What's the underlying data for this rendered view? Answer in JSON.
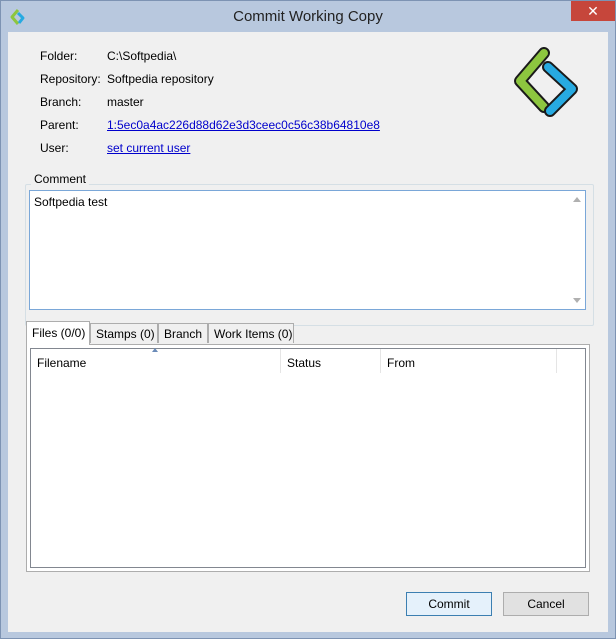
{
  "window": {
    "title": "Commit Working Copy",
    "close_glyph": "✕"
  },
  "info": {
    "folder_label": "Folder:",
    "folder_value": "C:\\Softpedia\\",
    "repository_label": "Repository:",
    "repository_value": "Softpedia repository",
    "branch_label": "Branch:",
    "branch_value": "master",
    "parent_label": "Parent:",
    "parent_value": "1:5ec0a4ac226d88d62e3d3ceec0c56c38b64810e8",
    "user_label": "User:",
    "user_value": "set current user"
  },
  "comment": {
    "label": "Comment",
    "text": "Softpedia test"
  },
  "tabs": [
    {
      "label": "Files (0/0)"
    },
    {
      "label": "Stamps (0)"
    },
    {
      "label": "Branch"
    },
    {
      "label": "Work Items (0)"
    }
  ],
  "columns": [
    {
      "label": "Filename"
    },
    {
      "label": "Status"
    },
    {
      "label": "From"
    }
  ],
  "buttons": {
    "commit": "Commit",
    "cancel": "Cancel"
  },
  "colors": {
    "logo_green": "#8dc63f",
    "logo_blue": "#27aae1",
    "link": "#0000cc"
  },
  "icons": {
    "app": "plastic-logo-icon",
    "close": "close-icon"
  }
}
